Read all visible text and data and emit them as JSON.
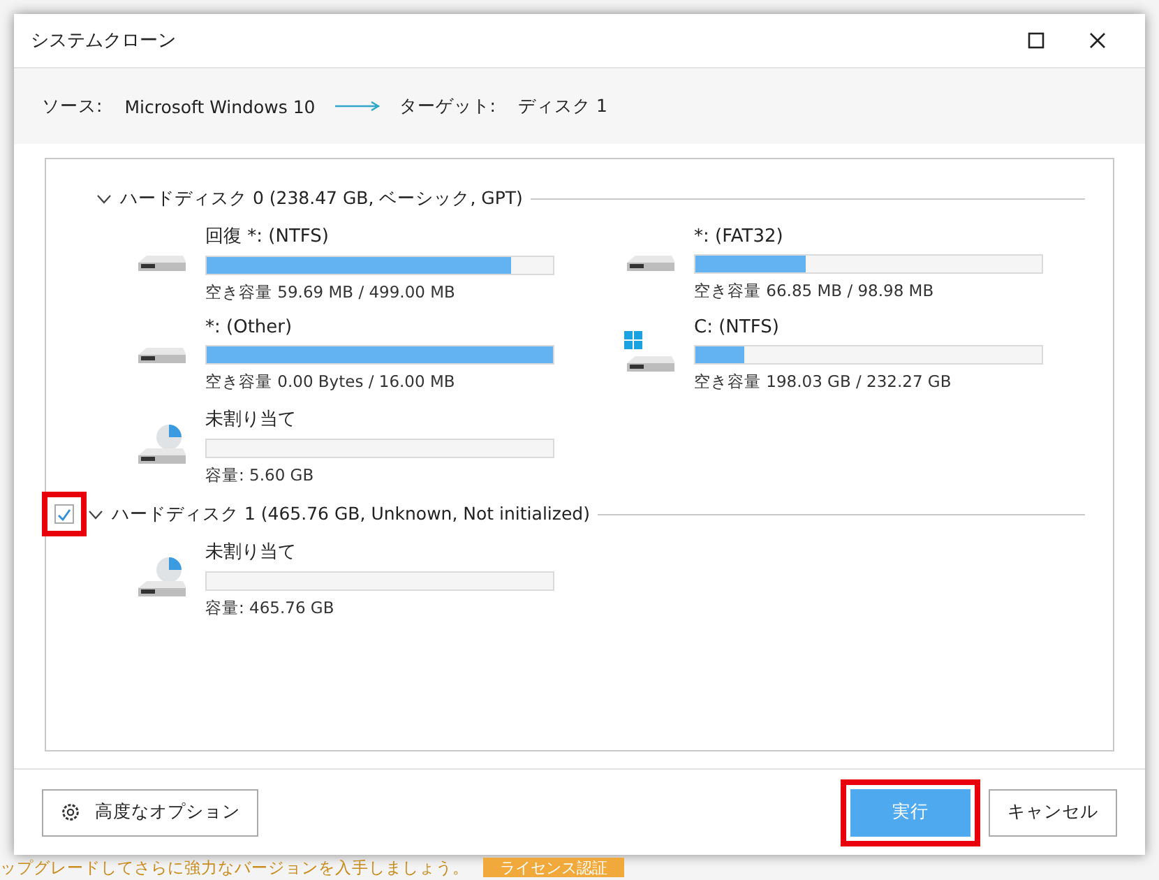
{
  "window": {
    "title": "システムクローン"
  },
  "route": {
    "source_label": "ソース:",
    "source": "Microsoft Windows 10",
    "target_label": "ターゲット:",
    "target": "ディスク 1"
  },
  "disks": [
    {
      "title": "ハードディスク 0 (238.47 GB, ベーシック, GPT)",
      "expanded": true,
      "partitions": [
        {
          "kind": "drive",
          "name": "回復 *: (NTFS)",
          "level": 0.88,
          "usage": "空き容量 59.69 MB / 499.00 MB"
        },
        {
          "kind": "drive",
          "name": "*: (FAT32)",
          "level": 0.32,
          "usage": "空き容量 66.85 MB / 98.98 MB"
        },
        {
          "kind": "drive",
          "name": "*: (Other)",
          "level": 1,
          "usage": "空き容量 0.00 Bytes / 16.00 MB"
        },
        {
          "kind": "windows",
          "name": "C: (NTFS)",
          "level": 0.14,
          "usage": "空き容量 198.03 GB / 232.27 GB"
        },
        {
          "kind": "unallocated",
          "name": "未割り当て",
          "usage": "容量: 5.60 GB"
        }
      ]
    },
    {
      "title": "ハードディスク 1 (465.76 GB, Unknown, Not initialized)",
      "expanded": true,
      "checked": true,
      "highlighted": true,
      "partitions": [
        {
          "kind": "unallocated",
          "name": "未割り当て",
          "usage": "容量: 465.76 GB"
        }
      ]
    }
  ],
  "footer": {
    "options_button": "高度なオプション",
    "run_button": {
      "label": "実行",
      "highlighted": true
    },
    "cancel_button": "キャンセル"
  },
  "background": {
    "notice": "ップグレードしてさらに強力なバージョンを入手しましょう。",
    "license_button": "ライセンス認証"
  }
}
